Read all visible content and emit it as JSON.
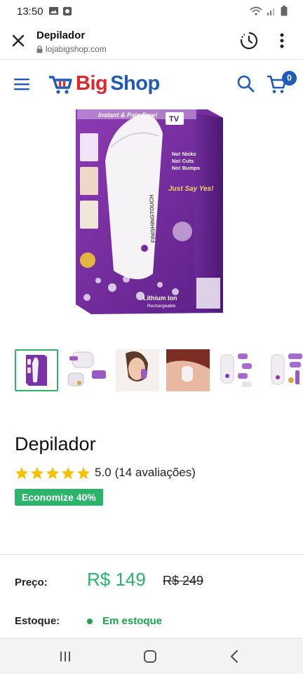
{
  "status": {
    "time": "13:50"
  },
  "browser": {
    "title": "Depilador",
    "url": "lojabigshop.com"
  },
  "store": {
    "logo_big": "Big",
    "logo_shop": "Shop",
    "cart_count": "0",
    "colors": {
      "brand_red": "#e3262b",
      "brand_blue": "#1f5bb8",
      "accent_green": "#2ab56a"
    }
  },
  "product": {
    "box_text": {
      "top_banner": "Instant & Pain Free!",
      "tv": "TV",
      "features": [
        "No! Nicks",
        "No! Cuts",
        "No! Bumps"
      ],
      "slogan": "Just Say Yes!",
      "device_brand": "FINISHINGTOUCH",
      "battery": "Lithium Ion",
      "battery_sub": "Rechargeable"
    },
    "thumbnails": [
      {
        "name": "box",
        "active": true
      },
      {
        "name": "device-parts",
        "active": false
      },
      {
        "name": "face-use",
        "active": false
      },
      {
        "name": "underarm-use",
        "active": false
      },
      {
        "name": "device-set",
        "active": false
      },
      {
        "name": "device-accessories",
        "active": false
      }
    ],
    "title": "Depilador",
    "rating_value": 5,
    "rating": "5.0",
    "reviews": "(14 avaliações)",
    "savings": "Economize 40%",
    "price_label": "Preço:",
    "price": "R$ 149",
    "price_old": "R$ 249",
    "stock_label": "Estoque:",
    "stock": "Em estoque"
  }
}
